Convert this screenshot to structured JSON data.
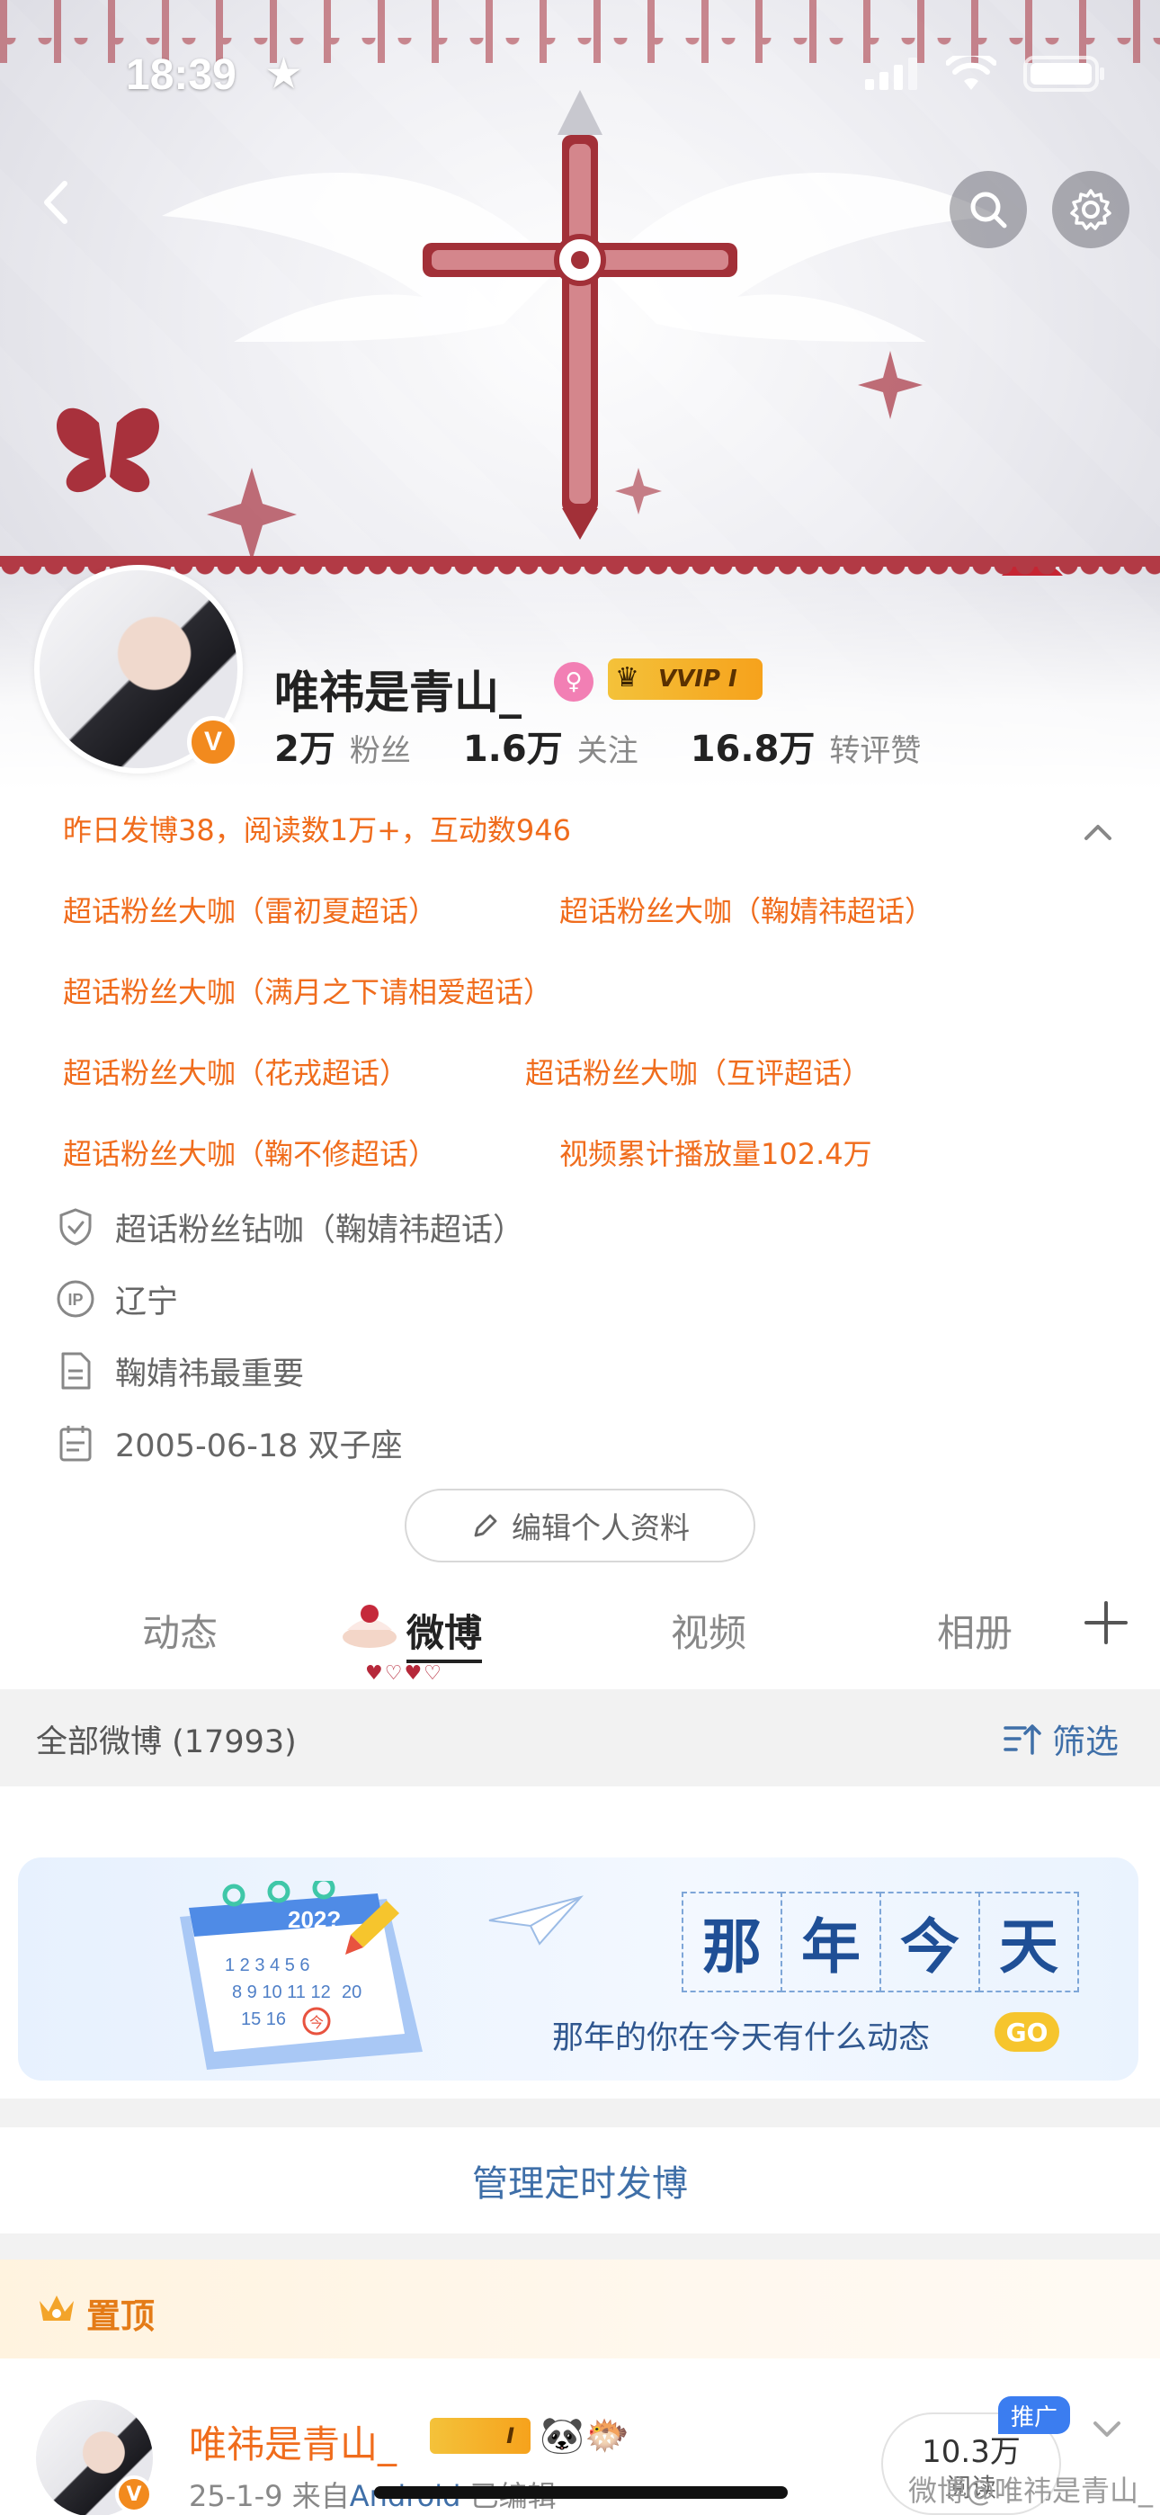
{
  "status_bar": {
    "time": "18:39",
    "star": "★"
  },
  "nav": {
    "back_icon": "chevron-left-icon",
    "search_icon": "search-icon",
    "settings_icon": "gear-icon"
  },
  "profile": {
    "username": "唯祎是青山_",
    "gender_symbol": "♀",
    "vip_label": "VVIP I",
    "verified_badge": "V",
    "stats": [
      {
        "value": "2万",
        "label": "粉丝"
      },
      {
        "value": "1.6万",
        "label": "关注"
      },
      {
        "value": "16.8万",
        "label": "转评赞"
      }
    ]
  },
  "highlights": {
    "daily_summary": "昨日发博38，阅读数1万+，互动数946",
    "titles": [
      "超话粉丝大咖（雷初夏超话）",
      "超话粉丝大咖（鞠婧祎超话）",
      "超话粉丝大咖（满月之下请相爱超话）",
      "超话粉丝大咖（花戎超话）",
      "超话粉丝大咖（互评超话）",
      "超话粉丝大咖（鞠不修超话）",
      "视频累计播放量102.4万"
    ]
  },
  "info_rows": [
    {
      "icon": "shield-icon",
      "text": "超话粉丝钻咖（鞠婧祎超话）"
    },
    {
      "icon": "ip-icon",
      "text": "辽宁"
    },
    {
      "icon": "document-icon",
      "text": "鞠婧祎最重要"
    },
    {
      "icon": "calendar-icon",
      "text": "2005-06-18 双子座"
    }
  ],
  "edit_profile_label": "编辑个人资料",
  "tabs": [
    {
      "label": "动态",
      "active": false
    },
    {
      "label": "微博",
      "active": true
    },
    {
      "label": "视频",
      "active": false
    },
    {
      "label": "相册",
      "active": false
    }
  ],
  "tab_hearts": "♥♡♥♡",
  "filter": {
    "count_label": "全部微博 (17993)",
    "filter_label": "筛选"
  },
  "memory_banner": {
    "title_chars": [
      "那",
      "年",
      "今",
      "天"
    ],
    "subtitle": "那年的你在今天有什么动态",
    "go_label": "GO",
    "calendar_year": "202?",
    "calendar_numbers": "1 2 3 4 5 6 / 8 9 10 11 12 / 15 16 今 20",
    "today_char": "今"
  },
  "scheduled_label": "管理定时发博",
  "pinned": {
    "label": "置顶",
    "post": {
      "author": "唯祎是青山_",
      "badge": "I",
      "emojis": [
        "🐼",
        "🐡"
      ],
      "date": "25-1-9",
      "from_prefix": "来自",
      "source": "Android",
      "edited": "已编辑",
      "reads_value": "10.3万",
      "reads_label": "阅读",
      "promo_label": "推广"
    }
  },
  "watermark": "微博@唯祎是青山_",
  "colors": {
    "orange": "#f06c1c",
    "link_blue": "#3f6fa8",
    "gold": "#f4c23a",
    "accent_red": "#a8313c"
  }
}
